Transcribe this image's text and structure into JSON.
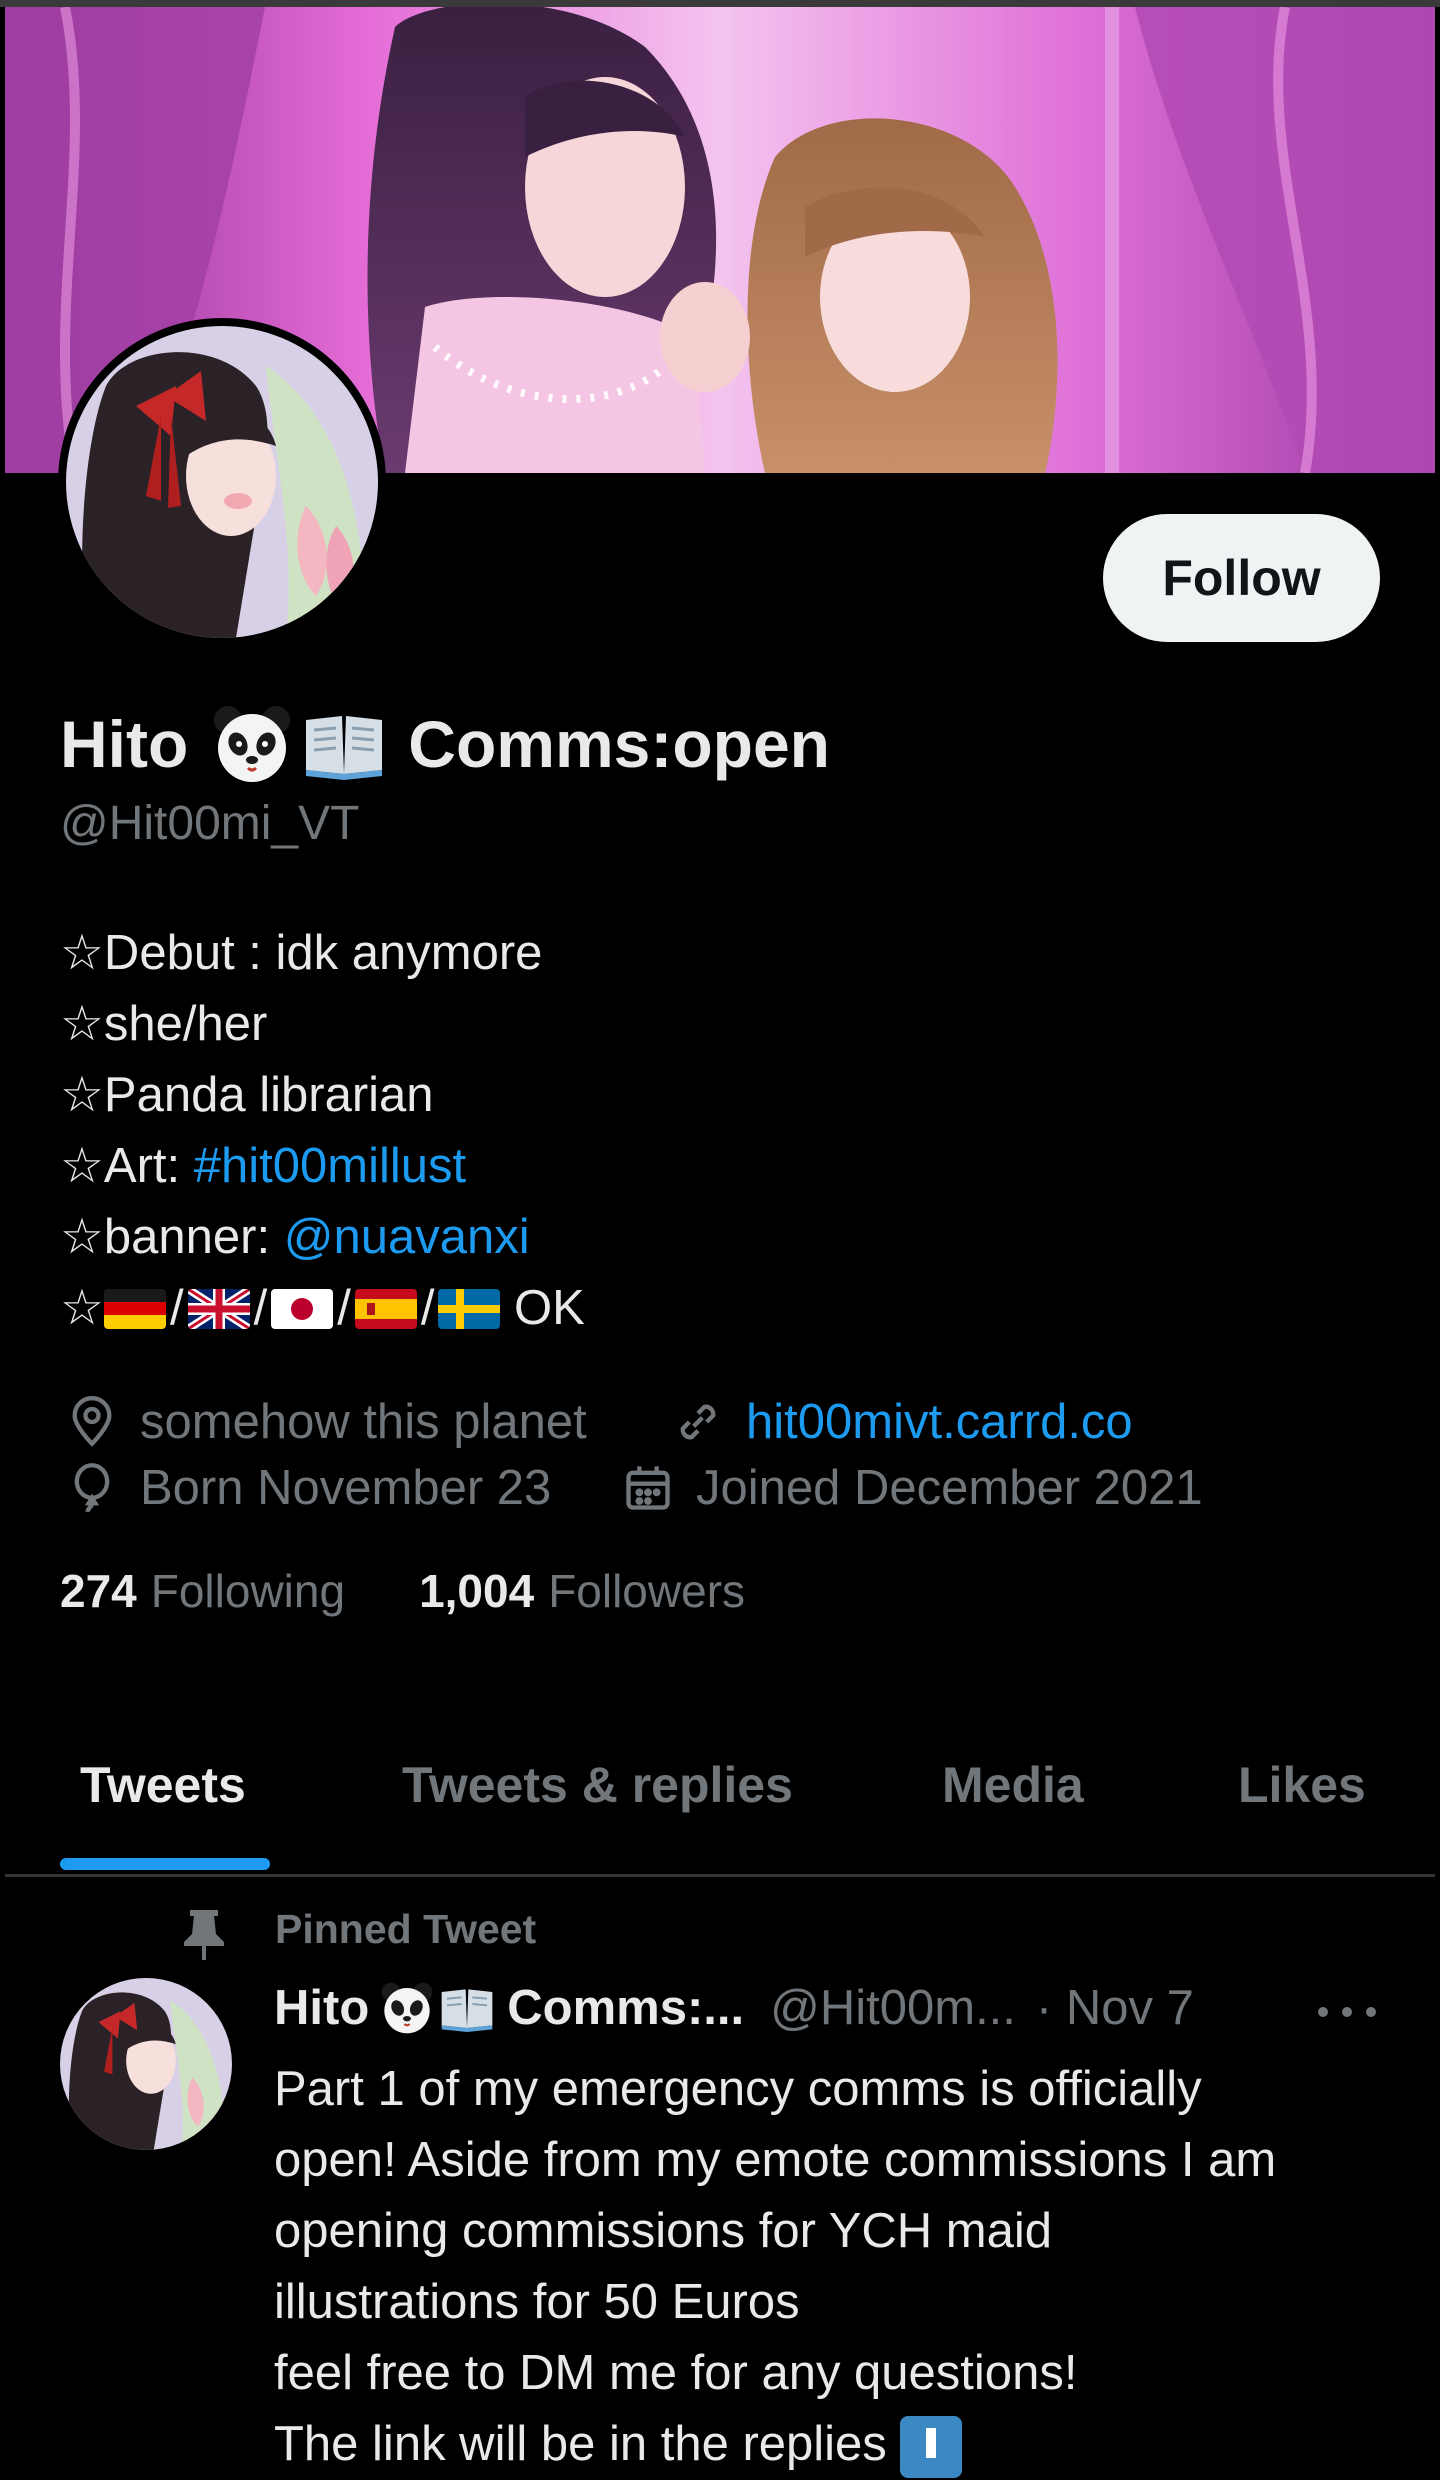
{
  "profile": {
    "display_name_prefix": "Hito",
    "display_name_suffix": "Comms:open",
    "handle": "@Hit00mi_VT",
    "follow_label": "Follow"
  },
  "bio": {
    "line1": "☆Debut : idk anymore",
    "line2": "☆she/her",
    "line3": "☆Panda librarian",
    "line4_text": "☆Art: ",
    "line4_link": "#hit00millust",
    "line5_text": "☆banner: ",
    "line5_link": "@nuavanxi",
    "line6_star": "☆",
    "line6_slash": "/",
    "line6_ok": " OK"
  },
  "meta": {
    "location": "somehow this planet",
    "website": "hit00mivt.carrd.co",
    "birthday": "Born November 23",
    "joined": "Joined December 2021"
  },
  "stats": {
    "following_count": "274",
    "following_label": "Following",
    "followers_count": "1,004",
    "followers_label": "Followers"
  },
  "tabs": [
    "Tweets",
    "Tweets & replies",
    "Media",
    "Likes"
  ],
  "pinned": {
    "label": "Pinned Tweet",
    "name_prefix": "Hito",
    "name_suffix": "Comms:...",
    "handle": "@Hit00m...",
    "date": "· Nov 7",
    "body": "Part 1 of my emergency comms is officially\nopen! Aside from my emote commissions I am\nopening commissions for YCH maid\nillustrations for 50 Euros\nfeel free to DM me for any questions!\nThe link will be in the replies "
  },
  "icons": {
    "location": "location-icon",
    "link": "link-icon",
    "birthday": "balloon-icon",
    "calendar": "calendar-icon",
    "pin": "pin-icon",
    "more": "more-icon",
    "panda": "panda-emoji",
    "book": "book-emoji"
  },
  "colors": {
    "background": "#000000",
    "accent": "#1d9bf0",
    "text": "#e7e9ea",
    "muted": "#71767b",
    "banner_pink": "#d066c8"
  }
}
